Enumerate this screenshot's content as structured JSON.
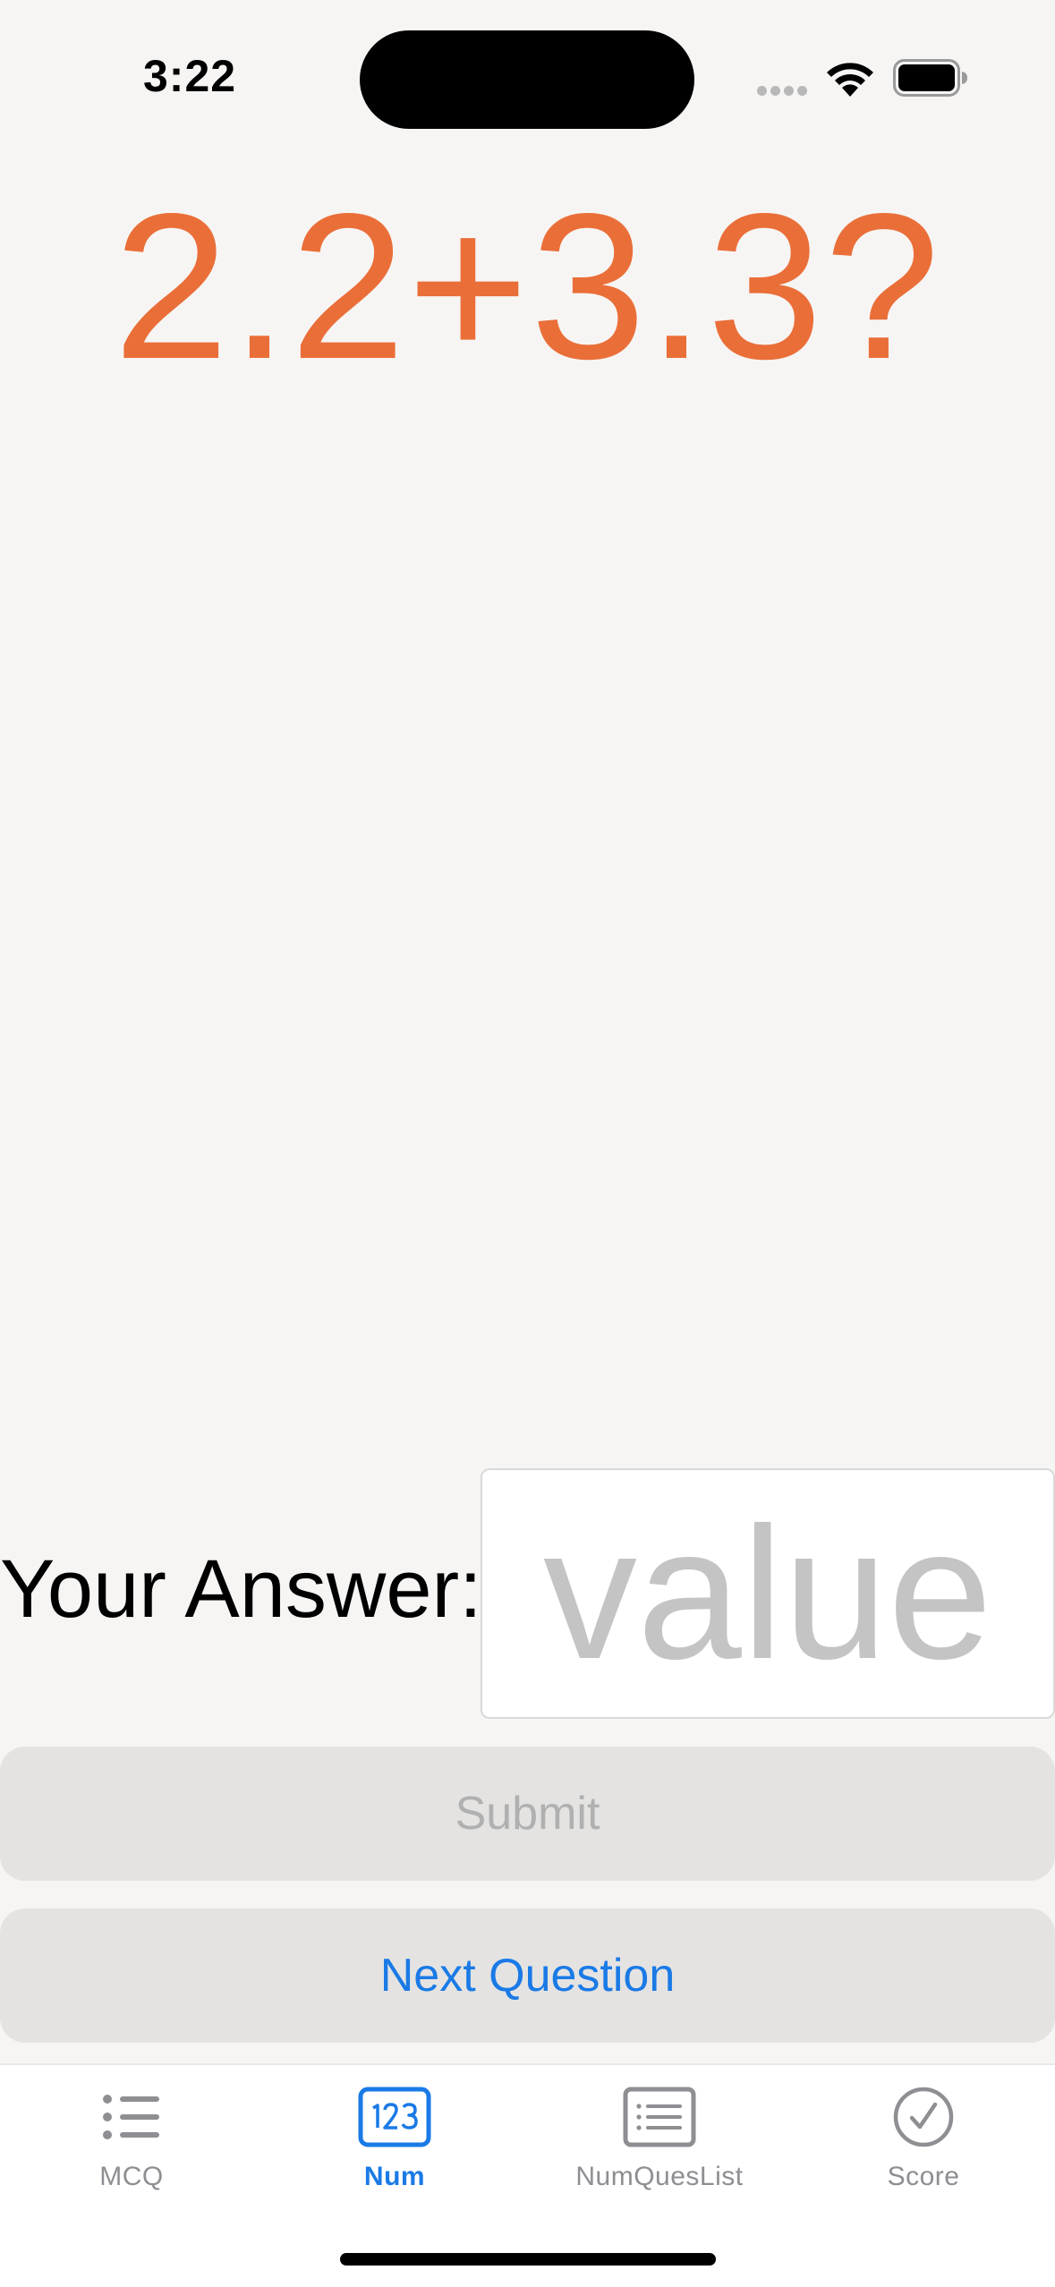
{
  "status_bar": {
    "time": "3:22"
  },
  "question": {
    "text": "2.2+3.3?"
  },
  "answer": {
    "label": "Your Answer:",
    "placeholder": "value",
    "value": ""
  },
  "buttons": {
    "submit": "Submit",
    "next": "Next Question"
  },
  "tabs": [
    {
      "label": "MCQ",
      "icon": "list-bullet-icon",
      "active": false
    },
    {
      "label": "Num",
      "icon": "number-123-icon",
      "active": true
    },
    {
      "label": "NumQuesList",
      "icon": "list-rectangle-icon",
      "active": false
    },
    {
      "label": "Score",
      "icon": "checkmark-circle-icon",
      "active": false
    }
  ],
  "colors": {
    "accent": "#1a7ae6",
    "question": "#ea6e38",
    "background": "#f7f5f4",
    "button_bg": "#e4e3e2",
    "inactive": "#8e8e93"
  }
}
